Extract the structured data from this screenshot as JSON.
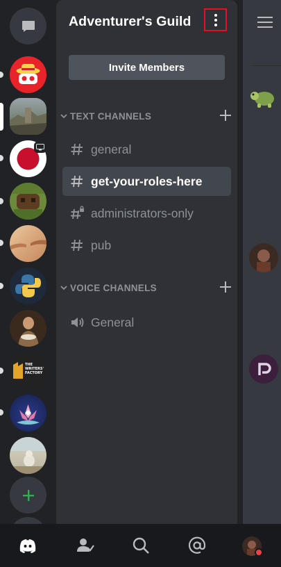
{
  "server_name": "Adventurer's Guild",
  "invite_button_label": "Invite Members",
  "categories": {
    "text": {
      "label": "TEXT CHANNELS"
    },
    "voice": {
      "label": "VOICE CHANNELS"
    }
  },
  "text_channels": [
    {
      "name": "general",
      "icon": "hash-icon",
      "selected": false
    },
    {
      "name": "get-your-roles-here",
      "icon": "hash-icon",
      "selected": true
    },
    {
      "name": "administrators-only",
      "icon": "locked-hash-icon",
      "selected": false
    },
    {
      "name": "pub",
      "icon": "hash-icon",
      "selected": false
    }
  ],
  "voice_channels": [
    {
      "name": "General",
      "icon": "speaker-icon"
    }
  ],
  "server_rail_logo_text": "THE WRITERS' FACTORY",
  "colors": {
    "accent_green": "#3ba55d",
    "highlight_red": "#e8101d",
    "panel_bg": "#2f3136",
    "rail_bg": "#202225",
    "selected_channel_bg": "#42464d"
  },
  "bottom_nav": [
    "home-icon",
    "friends-icon",
    "search-icon",
    "mentions-icon",
    "profile-avatar"
  ]
}
